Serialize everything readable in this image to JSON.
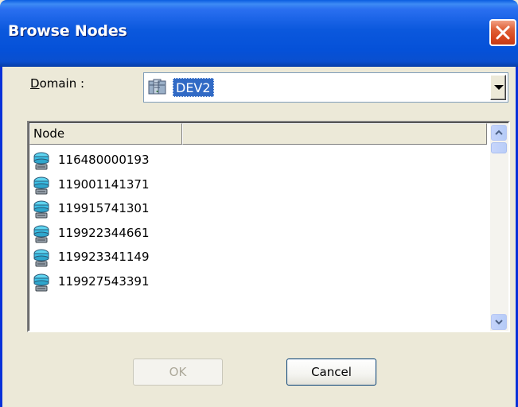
{
  "window": {
    "title": "Browse Nodes"
  },
  "domain": {
    "label_underlined": "D",
    "label_rest": "omain :",
    "value": "DEV2"
  },
  "list": {
    "column_node": "Node",
    "rows": [
      {
        "label": "116480000193"
      },
      {
        "label": "119001141371"
      },
      {
        "label": "119915741301"
      },
      {
        "label": "119922344661"
      },
      {
        "label": "119923341149"
      },
      {
        "label": "119927543391"
      }
    ]
  },
  "buttons": {
    "ok": "OK",
    "cancel": "Cancel"
  },
  "icons": {
    "domain": "server-icon",
    "node": "computer-node-icon"
  },
  "colors": {
    "titlebar": "#0a58dd",
    "selection": "#316ac5",
    "close": "#d8481f"
  }
}
